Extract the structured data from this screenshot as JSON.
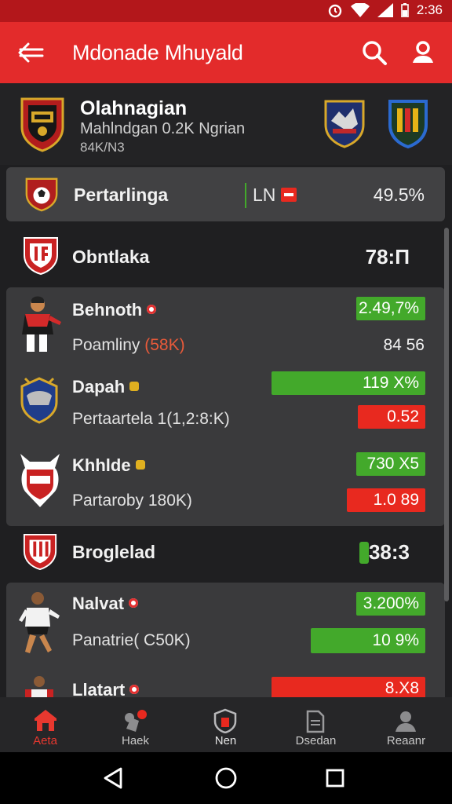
{
  "status_bar": {
    "time": "2:36"
  },
  "app_bar": {
    "title": "Mdonade Mhuyald"
  },
  "team": {
    "name": "Olahnagian",
    "subtitle": "Mahlndgan 0.2K Ngrian",
    "meta": "84K/N3"
  },
  "league_row": {
    "label": "Pertarlinga",
    "code": "LN",
    "value": "49.5%"
  },
  "sections": [
    {
      "title": "Obntlaka",
      "score": "78:Π",
      "players": [
        {
          "name": "Behnoth",
          "detail": "Poamliny",
          "detail_extra": "(58K)",
          "badge": "2.49,7%",
          "badge_color": "green",
          "value": "84 56"
        },
        {
          "name": "Dapah",
          "detail": "Pertaartela 1(1,2:8:K)",
          "badge": "119 X%",
          "badge_color": "green",
          "value": "0.52",
          "value_color": "red"
        },
        {
          "name": "Khhlde",
          "detail": "Partaroby 180K)",
          "badge": "730 X5",
          "badge_color": "green",
          "value": "1.0 89",
          "value_color": "red"
        }
      ]
    },
    {
      "title": "Broglelad",
      "score": "38:3",
      "players": [
        {
          "name": "Nalvat",
          "detail": "Panatrie( C50K)",
          "badge": "3.200%",
          "badge_color": "green",
          "value": "10 9%",
          "value_color": "green"
        },
        {
          "name": "Llatart",
          "badge": "8.X8",
          "badge_color": "red"
        }
      ]
    }
  ],
  "bottom_nav": [
    {
      "label": "Aeta",
      "icon": "home-icon",
      "active": true
    },
    {
      "label": "Haek",
      "icon": "notification-icon",
      "active": false
    },
    {
      "label": "Nen",
      "icon": "shield-icon",
      "active": false
    },
    {
      "label": "Dsedan",
      "icon": "document-icon",
      "active": false
    },
    {
      "label": "Reaanr",
      "icon": "person-icon",
      "active": false
    }
  ],
  "colors": {
    "accent": "#e32b2b",
    "status_bar": "#b3171b",
    "positive": "#43a92b",
    "negative": "#e8291f",
    "background": "#1f1f21"
  }
}
